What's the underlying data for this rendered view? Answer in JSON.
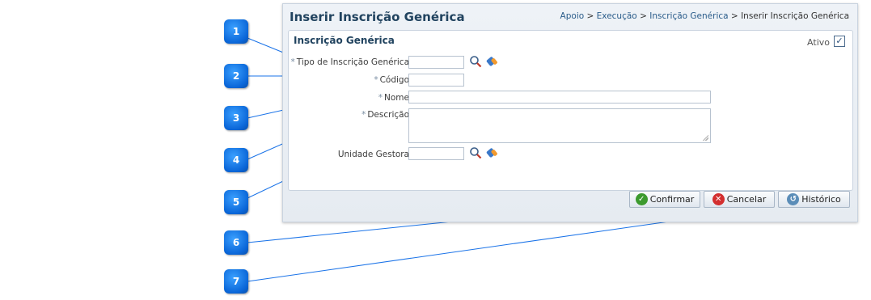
{
  "page": {
    "title": "Inserir Inscrição Genérica",
    "breadcrumb": [
      "Apoio",
      "Execução",
      "Inscrição Genérica",
      "Inserir Inscrição Genérica"
    ],
    "breadcrumb_separator": ">"
  },
  "form": {
    "subtitle": "Inscrição Genérica",
    "ativo_label": "Ativo",
    "ativo_checked": true,
    "required_marker": "*",
    "fields": {
      "tipo": {
        "label": "Tipo de Inscrição Genérica",
        "value": ""
      },
      "codigo": {
        "label": "Código",
        "value": ""
      },
      "nome": {
        "label": "Nome",
        "value": ""
      },
      "descricao": {
        "label": "Descrição",
        "value": ""
      },
      "unidade": {
        "label": "Unidade Gestora",
        "value": ""
      }
    }
  },
  "buttons": {
    "confirmar": "Confirmar",
    "cancelar": "Cancelar",
    "historico": "Histórico"
  },
  "callouts": [
    "1",
    "2",
    "3",
    "4",
    "5",
    "6",
    "7"
  ],
  "colors": {
    "title": "#21435f",
    "callout": "#0a66d8",
    "line": "#1a73e8"
  },
  "icons": {
    "lookup": "magnifier-icon",
    "clear": "eraser-icon",
    "confirm": "check-circle-icon",
    "cancel": "x-circle-icon",
    "history": "history-icon"
  }
}
